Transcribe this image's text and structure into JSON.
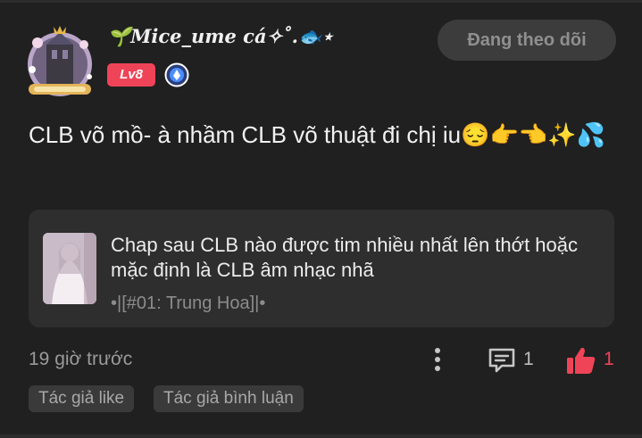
{
  "author": {
    "name": "🌱𝑴𝒊𝒄𝒆_𝒖𝒎𝒆 𝒄á✧˚.🐟⋆",
    "level": "Lv8"
  },
  "follow_button": "Đang theo dõi",
  "post": {
    "text": "CLB võ mồ- à nhầm CLB võ thuật đi chị iu😔👉👈✨💦"
  },
  "linked_card": {
    "title": "Chap sau CLB nào được tim nhiều nhất lên thớt hoặc mặc định là CLB âm nhạc nhã",
    "subtitle": "•|[#01: Trung Hoa]|•"
  },
  "footer": {
    "timestamp": "19 giờ trước",
    "comment_count": "1",
    "like_count": "1",
    "tags": [
      "Tác giả like",
      "Tác giả bình luận"
    ]
  },
  "colors": {
    "background": "#202020",
    "card": "#2e2e2e",
    "accent": "#ef4458",
    "button": "#3c3c3c"
  },
  "icons": {
    "more": "more-vertical-icon",
    "comment": "comment-icon",
    "like": "thumbs-up-icon",
    "member": "member-badge-icon"
  }
}
